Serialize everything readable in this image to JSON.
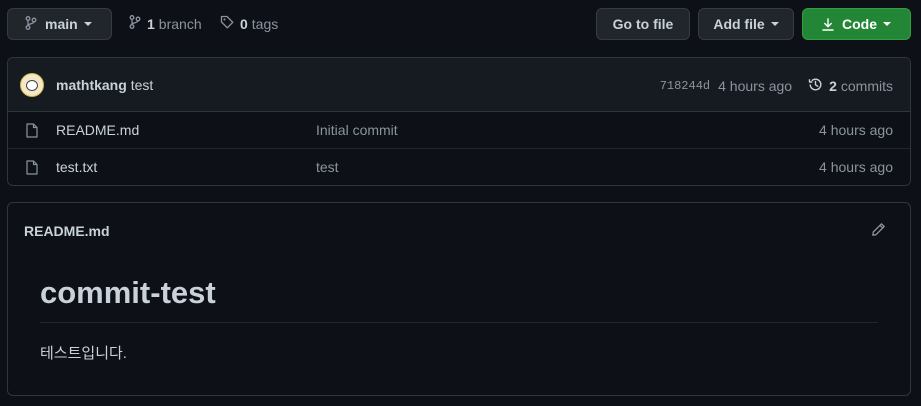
{
  "toolbar": {
    "branch_label": "main",
    "branch_count": "1",
    "branch_word": "branch",
    "tag_count": "0",
    "tag_word": "tags",
    "goto_label": "Go to file",
    "add_file_label": "Add file",
    "code_label": "Code",
    "accent": "#238636"
  },
  "latest_commit": {
    "author": "mathtkang",
    "message": "test",
    "sha": "718244d",
    "time": "4 hours ago",
    "commit_count": "2",
    "commit_word": "commits"
  },
  "files": [
    {
      "name": "README.md",
      "message": "Initial commit",
      "time": "4 hours ago",
      "icon": "file-icon"
    },
    {
      "name": "test.txt",
      "message": "test",
      "time": "4 hours ago",
      "icon": "file-icon"
    }
  ],
  "readme": {
    "header": "README.md",
    "title": "commit-test",
    "body": "테스트입니다."
  }
}
